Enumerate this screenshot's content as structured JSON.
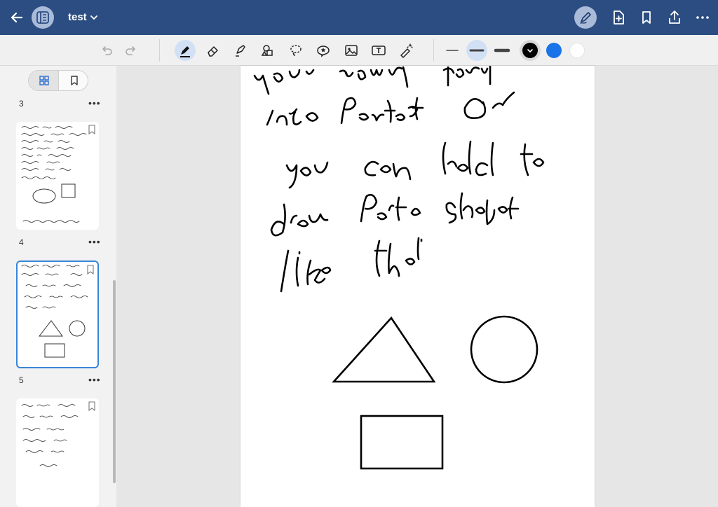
{
  "app": {
    "title": "test",
    "accent_color": "#2c4d82"
  },
  "topbar": {
    "icons": [
      "back-arrow-icon",
      "sidebar-toggle-icon",
      "chevron-down-icon",
      "pen-mode-icon",
      "add-page-icon",
      "bookmark-icon",
      "share-icon",
      "more-icon"
    ]
  },
  "toolbar": {
    "tools": [
      "undo",
      "redo",
      "pen",
      "eraser",
      "highlighter",
      "shapes",
      "lasso",
      "stickers",
      "image",
      "text",
      "laser"
    ],
    "active_tool": "pen",
    "stroke_widths": [
      "thin",
      "medium",
      "thick"
    ],
    "selected_width": "medium",
    "colors": [
      "#000000",
      "#1a73e8",
      "#ffffff"
    ],
    "selected_color": "#000000"
  },
  "sidebar": {
    "active_view": "thumbnails",
    "pages": [
      {
        "number": "3",
        "menu": "•••",
        "selected": false
      },
      {
        "number": "4",
        "menu": "•••",
        "selected": true
      },
      {
        "number": "5",
        "menu": "•••",
        "selected": false
      }
    ]
  },
  "page": {
    "handwriting_lines": [
      "your drawn shape",
      "into perfect or",
      "you can hold to",
      "draw perfect shape",
      "like this."
    ],
    "shapes": [
      "triangle",
      "circle",
      "rectangle"
    ]
  }
}
